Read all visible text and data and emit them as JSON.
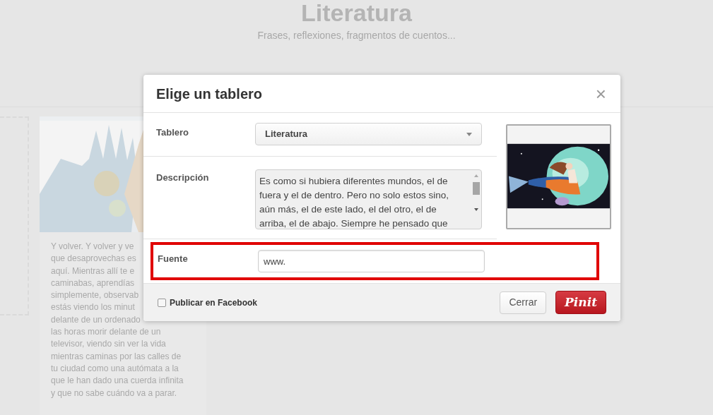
{
  "board_header": {
    "title": "Literatura",
    "subtitle": "Frases, reflexiones, fragmentos de cuentos..."
  },
  "pin_card": {
    "text_lines": [
      "Y volver. Y volver y ve",
      "que desaprovechas es",
      "aquí. Mientras allí te e",
      "caminabas, aprendías",
      "simplemente, observab",
      "estás viendo los minut",
      "delante de un ordenado",
      "las horas morir delante de un",
      "televisor, viendo sin ver la vida",
      "mientras caminas por las calles de",
      "tu ciudad como una autómata a la",
      "que le han dado una cuerda infinita",
      "y que no sabe cuándo va a parar."
    ]
  },
  "dialog": {
    "title": "Elige un tablero",
    "close": "×",
    "board": {
      "label": "Tablero",
      "value": "Literatura"
    },
    "description": {
      "label": "Descripción",
      "value": "Es como si hubiera diferentes mundos, el de fuera y el de dentro. Pero no solo estos sino, aún más, el de este lado, el del otro, el de arriba, el de abajo. Siempre he pensado que"
    },
    "source": {
      "label": "Fuente",
      "value": "www.",
      "highlighted": true
    },
    "facebook": {
      "label": "Publicar en Facebook",
      "checked": false
    },
    "buttons": [
      {
        "kind": "secondary",
        "label": "Cerrar"
      },
      {
        "kind": "primary",
        "label": "Pinit"
      }
    ]
  }
}
